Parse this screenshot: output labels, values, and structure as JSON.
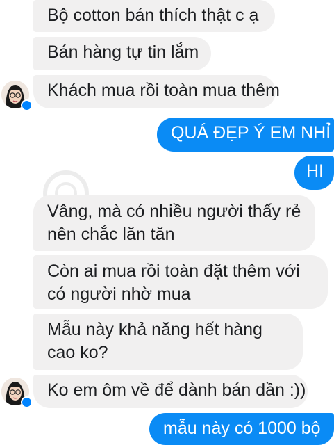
{
  "conversation": {
    "messages": [
      {
        "side": "received",
        "text": "Bộ cotton bán thích thật c ạ"
      },
      {
        "side": "received",
        "text": "Bán hàng tự tin lắm"
      },
      {
        "side": "received",
        "text": "Khách mua rồi toàn mua thêm"
      },
      {
        "side": "sent",
        "text": "QUÁ ĐẸP Ý EM NHỈ"
      },
      {
        "side": "sent",
        "text": "HI"
      },
      {
        "side": "received",
        "text": "Vâng, mà có nhiều người thấy rẻ nên chắc lăn tăn"
      },
      {
        "side": "received",
        "text": "Còn ai mua rồi toàn đặt thêm với có người nhờ mua"
      },
      {
        "side": "received",
        "text": "Mẫu này khả năng hết hàng cao ko?"
      },
      {
        "side": "received",
        "text": "Ko em ôm về để dành bán dần :))"
      },
      {
        "side": "sent",
        "text": "mẫu này có 1000 bộ"
      }
    ]
  },
  "avatar_icon": "person-avatar-icon",
  "badge_icon": "messenger-badge-icon",
  "colors": {
    "received_bubble": "#f1f0f0",
    "sent_bubble": "#0a8bf5",
    "received_text": "#1c1e21",
    "sent_text": "#ffffff",
    "badge": "#0084ff"
  }
}
